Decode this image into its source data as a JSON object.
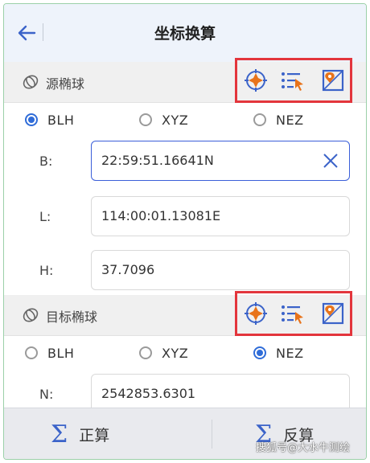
{
  "header": {
    "title": "坐标换算"
  },
  "source": {
    "title": "源椭球",
    "radios": [
      {
        "label": "BLH",
        "checked": true
      },
      {
        "label": "XYZ",
        "checked": false
      },
      {
        "label": "NEZ",
        "checked": false
      }
    ],
    "fields": [
      {
        "label": "B:",
        "value": "22:59:51.16641N"
      },
      {
        "label": "L:",
        "value": "114:00:01.13081E"
      },
      {
        "label": "H:",
        "value": "37.7096"
      }
    ]
  },
  "target": {
    "title": "目标椭球",
    "radios": [
      {
        "label": "BLH",
        "checked": false
      },
      {
        "label": "XYZ",
        "checked": false
      },
      {
        "label": "NEZ",
        "checked": true
      }
    ],
    "fields": [
      {
        "label": "N:",
        "value": "2542853.6301"
      }
    ]
  },
  "footer": {
    "forward_label": "正算",
    "inverse_label": "反算",
    "sigma": "Σ"
  },
  "watermark": "搜狐号@大水牛测绘",
  "icons": [
    "back-arrow-icon",
    "ellipsoid-icon",
    "gps-crosshair-icon",
    "point-list-icon",
    "map-pick-icon",
    "close-icon"
  ],
  "colors": {
    "accent": "#2f6cd8",
    "highlight_box": "#e3353c",
    "tool_orange": "#e8731a"
  }
}
